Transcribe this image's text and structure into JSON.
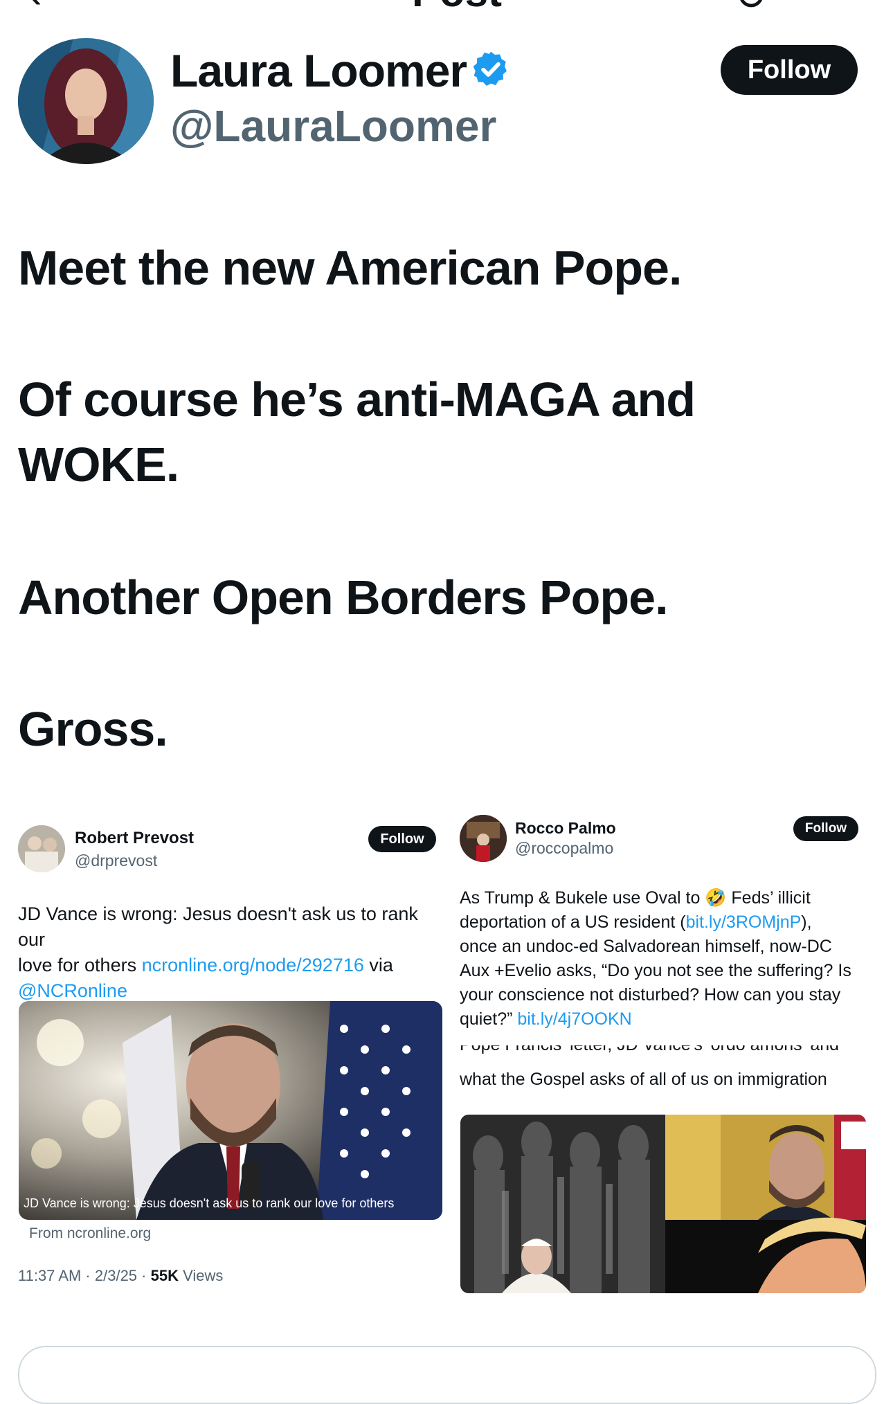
{
  "nav": {
    "title": "Post"
  },
  "author": {
    "name": "Laura Loomer",
    "handle": "@LauraLoomer",
    "follow_label": "Follow"
  },
  "post": {
    "lines": [
      "Meet the new American Pope.",
      "Of course he’s anti-MAGA and",
      "WOKE.",
      "Another Open Borders Pope.",
      "Gross."
    ]
  },
  "embed1": {
    "name": "Robert Prevost",
    "handle": "@drprevost",
    "follow_label": "Follow",
    "text_line1": "JD Vance is wrong: Jesus doesn't ask us to rank our",
    "text_line2_prefix": "love for others ",
    "link1": "ncronline.org/node/292716",
    "text_line2_suffix": " via",
    "mention": "@NCRonline",
    "card_caption": "JD Vance is wrong: Jesus doesn't ask us to rank our love for others",
    "card_source": "From ncronline.org",
    "time": "11:37 AM · 2/3/25 · ",
    "views_count": "55K",
    "views_label": " Views"
  },
  "embed2": {
    "name": "Rocco Palmo",
    "handle": "@roccopalmo",
    "follow_label": "Follow",
    "line1_a": "As Trump & Bukele use Oval to ",
    "emoji": "🤣",
    "line1_b": " Feds’ illicit",
    "line2_a": "deportation of a US resident (",
    "link1": "bit.ly/3ROMjnP",
    "line2_b": "),",
    "line3": "once an undoc-ed Salvadorean himself, now-DC",
    "line4": "Aux +Evelio asks, “Do you not see the suffering? Is",
    "line5": "your conscience not disturbed? How can you stay",
    "line6_a": "quiet?” ",
    "link2": "bit.ly/4j7OOKN",
    "cut_line": "Pope Francis' letter, JD Vance's 'ordo amoris' and",
    "headline": "what the Gospel asks of all of us on immigration"
  },
  "colors": {
    "text": "#0f1419",
    "secondary": "#536471",
    "link": "#1d9bf0",
    "verified": "#1d9bf0",
    "button": "#0f1419"
  },
  "icons": [
    "back-arrow-icon",
    "refresh-icon",
    "verified-badge-icon"
  ]
}
